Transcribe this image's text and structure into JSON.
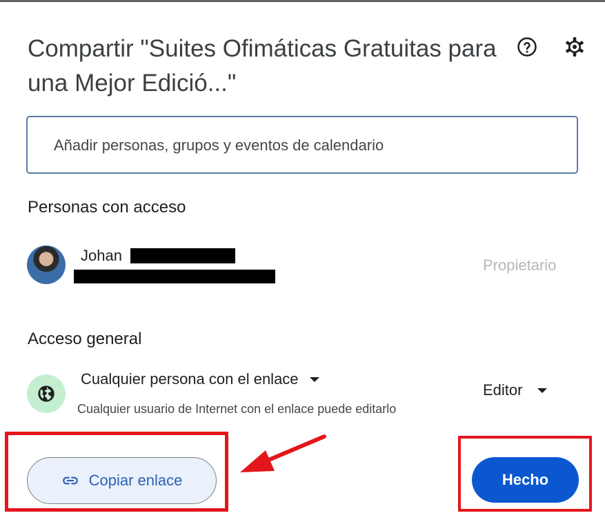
{
  "dialog": {
    "title": "Compartir \"Suites Ofimáticas Gratuitas para una Mejor Edició...\"",
    "icons": {
      "help": "help-circle-icon",
      "settings": "gear-icon"
    }
  },
  "add_people": {
    "placeholder": "Añadir personas, grupos y eventos de calendario"
  },
  "people_with_access": {
    "heading": "Personas con acceso",
    "users": [
      {
        "name": "Johan",
        "role": "Propietario"
      }
    ]
  },
  "general_access": {
    "heading": "Acceso general",
    "scope": "Cualquier persona con el enlace",
    "description": "Cualquier usuario de Internet con el enlace puede editarlo",
    "role": "Editor",
    "icon": "globe-icon"
  },
  "actions": {
    "copy_link": "Copiar enlace",
    "done": "Hecho"
  },
  "colors": {
    "primary": "#0b57d0",
    "annotation_red": "#e3161c",
    "globe_bg": "#c4eed0"
  }
}
